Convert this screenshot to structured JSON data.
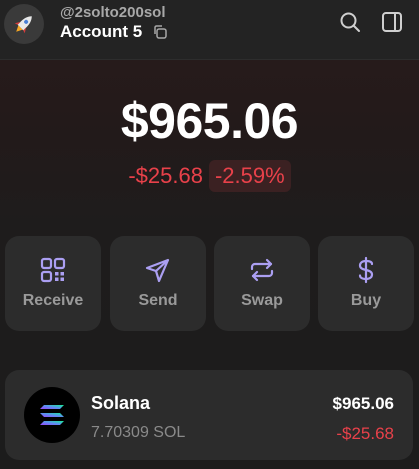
{
  "header": {
    "username": "@2solto200sol",
    "account_name": "Account 5"
  },
  "icons": {
    "avatar": "rocket-icon",
    "copy": "copy-icon",
    "search": "search-icon",
    "sidebar": "sidebar-panel-icon"
  },
  "balance": {
    "total": "$965.06",
    "change_amount": "-$25.68",
    "change_percent": "-2.59%"
  },
  "actions": [
    {
      "label": "Receive",
      "icon": "qr-code-icon"
    },
    {
      "label": "Send",
      "icon": "send-icon"
    },
    {
      "label": "Swap",
      "icon": "swap-icon"
    },
    {
      "label": "Buy",
      "icon": "dollar-icon"
    }
  ],
  "tokens": [
    {
      "name": "Solana",
      "quantity": "7.70309 SOL",
      "value": "$965.06",
      "change": "-$25.68",
      "icon": "solana-logo-icon"
    }
  ],
  "colors": {
    "accent": "#ab9ff2",
    "negative": "#e8414a",
    "card": "#2c2c2c",
    "background": "#1c1c1c"
  }
}
